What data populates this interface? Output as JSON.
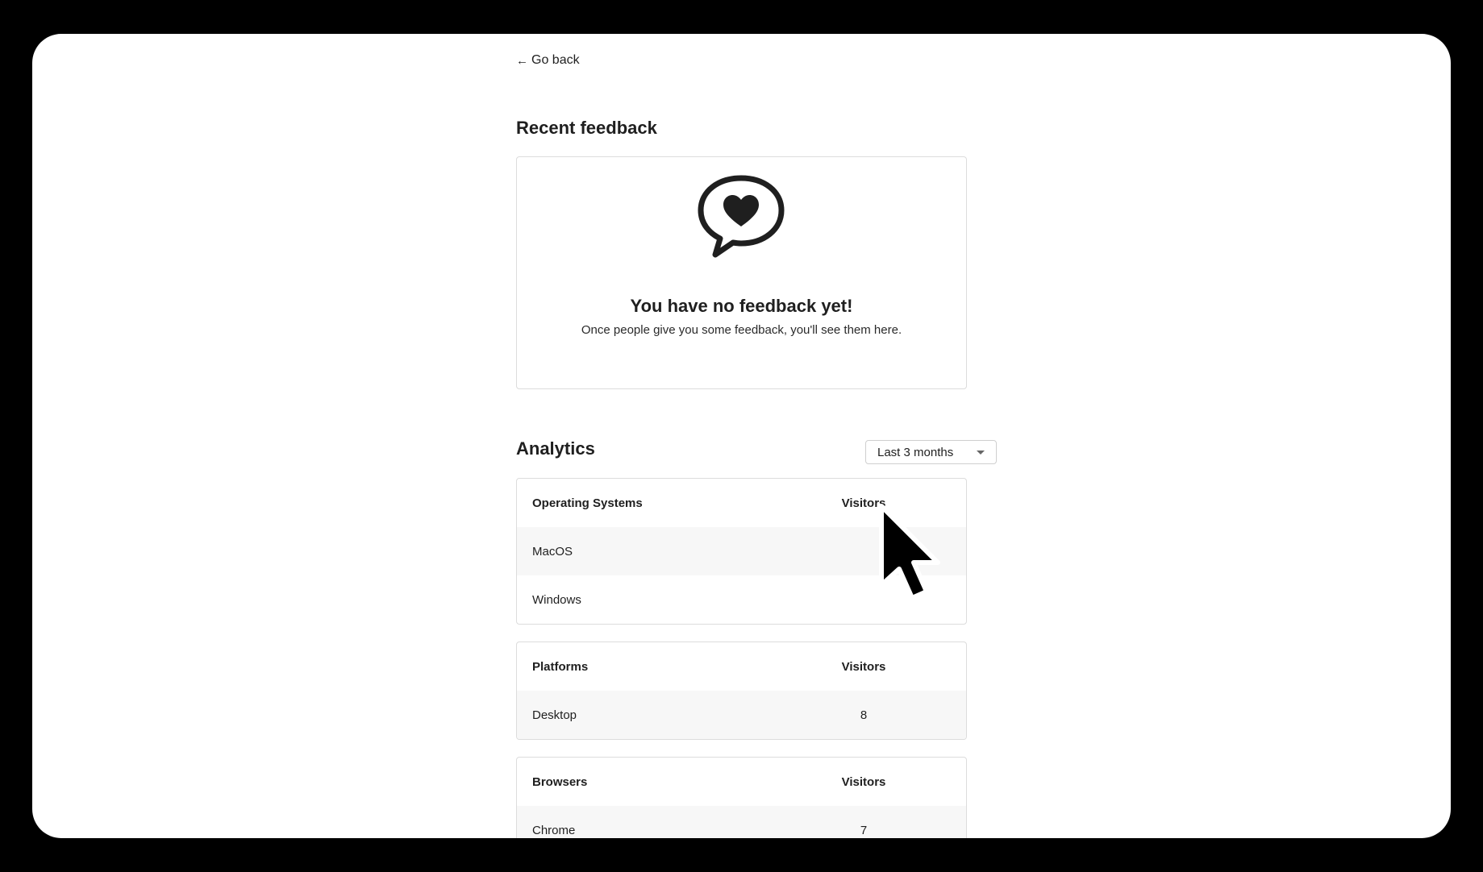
{
  "nav": {
    "back_label": "Go back",
    "back_icon": "arrow-left-icon"
  },
  "feedback": {
    "title": "Recent feedback",
    "icon": "heart-speech-bubble-icon",
    "empty_title": "You have no feedback yet!",
    "empty_subtitle": "Once people give you some feedback, you'll see them here."
  },
  "analytics": {
    "title": "Analytics",
    "range_selected": "Last 3 months",
    "tables": [
      {
        "header": [
          "Operating Systems",
          "Visitors"
        ],
        "rows": [
          [
            "MacOS",
            ""
          ],
          [
            "Windows",
            ""
          ]
        ]
      },
      {
        "header": [
          "Platforms",
          "Visitors"
        ],
        "rows": [
          [
            "Desktop",
            "8"
          ]
        ]
      },
      {
        "header": [
          "Browsers",
          "Visitors"
        ],
        "rows": [
          [
            "Chrome",
            "7"
          ]
        ]
      }
    ]
  },
  "colors": {
    "text": "#1f1f1f",
    "border": "#dcdcdc",
    "row_alt": "#f7f7f7"
  }
}
